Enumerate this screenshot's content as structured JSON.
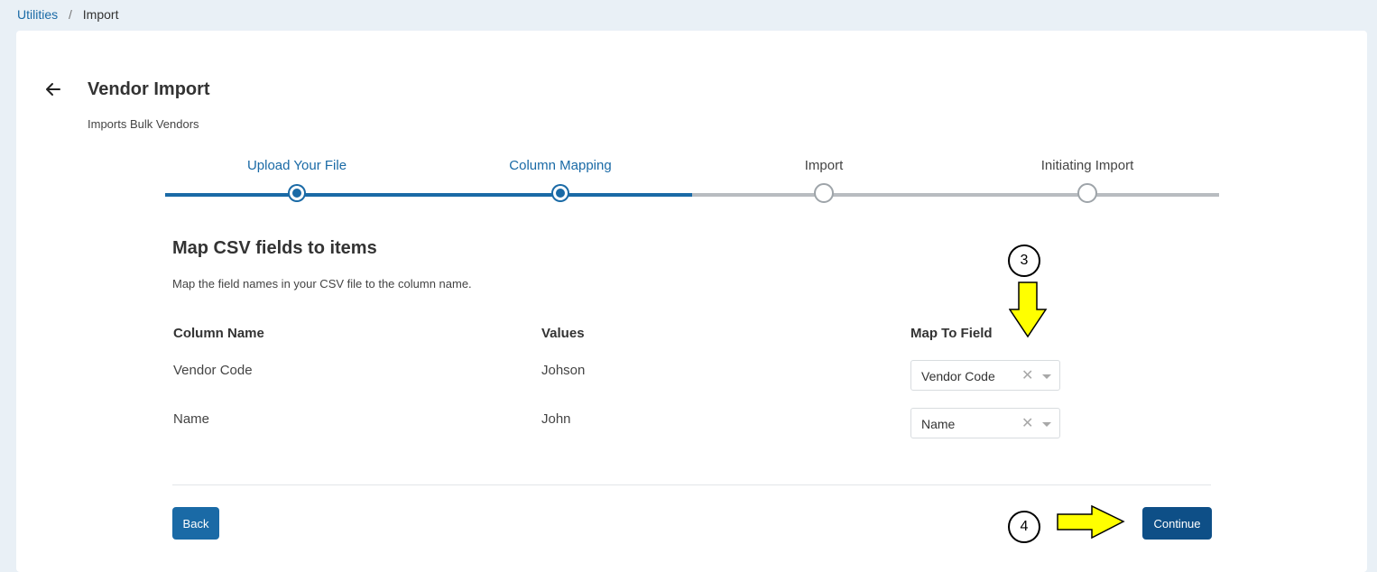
{
  "breadcrumb": {
    "parent": "Utilities",
    "separator": "/",
    "current": "Import"
  },
  "page": {
    "title": "Vendor Import",
    "subtitle": "Imports Bulk Vendors"
  },
  "stepper": {
    "steps": [
      {
        "label": "Upload Your File",
        "state": "complete"
      },
      {
        "label": "Column Mapping",
        "state": "complete"
      },
      {
        "label": "Import",
        "state": "pending"
      },
      {
        "label": "Initiating Import",
        "state": "pending"
      }
    ]
  },
  "mapping": {
    "title": "Map CSV fields to items",
    "description": "Map the field names in your CSV file to the column name.",
    "headers": {
      "column_name": "Column Name",
      "values": "Values",
      "map_to_field": "Map To Field"
    },
    "rows": [
      {
        "column_name": "Vendor Code",
        "value": "Johson",
        "mapped_field": "Vendor Code"
      },
      {
        "column_name": "Name",
        "value": "John",
        "mapped_field": "Name"
      }
    ]
  },
  "buttons": {
    "back": "Back",
    "continue": "Continue"
  },
  "annotations": {
    "step3": "3",
    "step4": "4"
  },
  "colors": {
    "primary": "#1a6aa6",
    "primary_dark": "#0e4f87",
    "inactive": "#b8bcc0",
    "background": "#e9f0f6",
    "annotation_arrow": "#ffff00"
  }
}
